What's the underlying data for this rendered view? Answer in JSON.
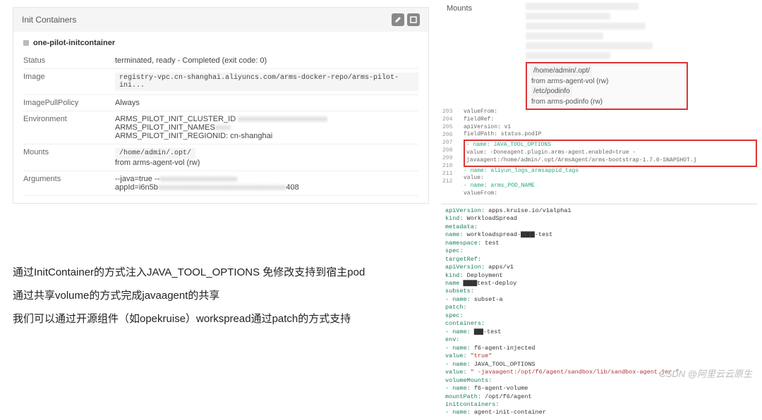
{
  "panel": {
    "headerTitle": "Init Containers",
    "containerName": "one-pilot-initcontainer",
    "rows": {
      "statusLabel": "Status",
      "statusValue": "terminated, ready - Completed (exit code: 0)",
      "imageLabel": "Image",
      "imageValue": "registry-vpc.cn-shanghai.aliyuncs.com/arms-docker-repo/arms-pilot-ini...",
      "pullLabel": "ImagePullPolicy",
      "pullValue": "Always",
      "envLabel": "Environment",
      "env1": "ARMS_PILOT_INIT_CLUSTER_ID",
      "env2": "ARMS_PILOT_INIT_NAMES",
      "env3": "ARMS_PILOT_INIT_REGIONID: cn-shanghai",
      "mountsLabel": "Mounts",
      "mountsPath": "/home/admin/.opt/",
      "mountsFrom": "from arms-agent-vol (rw)",
      "argsLabel": "Arguments",
      "args1": "--java=true --",
      "args2": "appId=i6n5b",
      "args2tail": "408"
    }
  },
  "text": {
    "line1": "通过InitContainer的方式注入JAVA_TOOL_OPTIONS 免修改支持到宿主pod",
    "line2": "通过共享volume的方式完成javaagent的共享",
    "line3": "我们可以通过开源组件（如opekruise）workspread通过patch的方式支持"
  },
  "rightMounts": {
    "label": "Mounts",
    "path1": "/home/admin/.opt/",
    "from1": "from arms-agent-vol (rw)",
    "path2": "/etc/podinfo",
    "from2": "from arms-podinfo (rw)"
  },
  "code1": {
    "lines": [
      "203",
      "204",
      "205",
      "206",
      "207",
      "208",
      "209",
      "210",
      "211",
      "212"
    ],
    "l1": "valueFrom:",
    "l2": "  fieldRef:",
    "l3": "    apiVersion: v1",
    "l4": "    fieldPath: status.podIP",
    "red1": "- name: JAVA_TOOL_OPTIONS",
    "red2": "  value:   -Doneagent.plugin.arms-agent.enabled=true -javaagent:/home/admin/.opt/ArmsAgent/arms-bootstrap-1.7.0-SNAPSHOT.j",
    "l5": "- name: aliyun_logs_armsappid_tags",
    "l6": "  value:",
    "l7": "- name: arms_POD_NAME",
    "l8": "  valueFrom:"
  },
  "yaml": {
    "l1k": "apiVersion:",
    "l1v": " apps.kruise.io/v1alpha1",
    "l2k": "kind:",
    "l2v": " WorkloadSpread",
    "l3k": "metadata:",
    "l4k": "  name:",
    "l4v": " workloadspread-▇▇▇-test",
    "l5k": "  namespace:",
    "l5v": " test",
    "l6k": "spec:",
    "l7k": "  targetRef:",
    "l8k": "    apiVersion:",
    "l8v": "  apps/v1",
    "l9k": "    kind:",
    "l9v": " Deployment",
    "l10k": "    name",
    "l10v": " ▇▇▇test-deploy",
    "l11k": "  subsets:",
    "l12k": "    - name:",
    "l12v": " subset-a",
    "l13k": "      patch:",
    "l14k": "        spec:",
    "l15k": "          containers:",
    "l16k": "            - name:",
    "l16v": " ▇▇-test",
    "l17k": "              env:",
    "l18k": "              - name:",
    "l18v": " f6-agent-injected",
    "l19k": "                value:",
    "l19v": " \"true\"",
    "l20k": "              - name:",
    "l20v": " JAVA_TOOL_OPTIONS",
    "l21k": "                value:",
    "l21v": " \" -javaagent:/opt/f6/agent/sandbox/lib/sandbox-agent.jar \"",
    "l22k": "          volumeMounts:",
    "l23k": "            - name:",
    "l23v": " f6-agent-volume",
    "l24k": "              mountPath:",
    "l24v": "  /opt/f6/agent",
    "l25k": "          initcontainers:",
    "l26k": "            - name:",
    "l26v": " agent-init-container"
  },
  "watermark": "CSDN @阿里云云原生"
}
